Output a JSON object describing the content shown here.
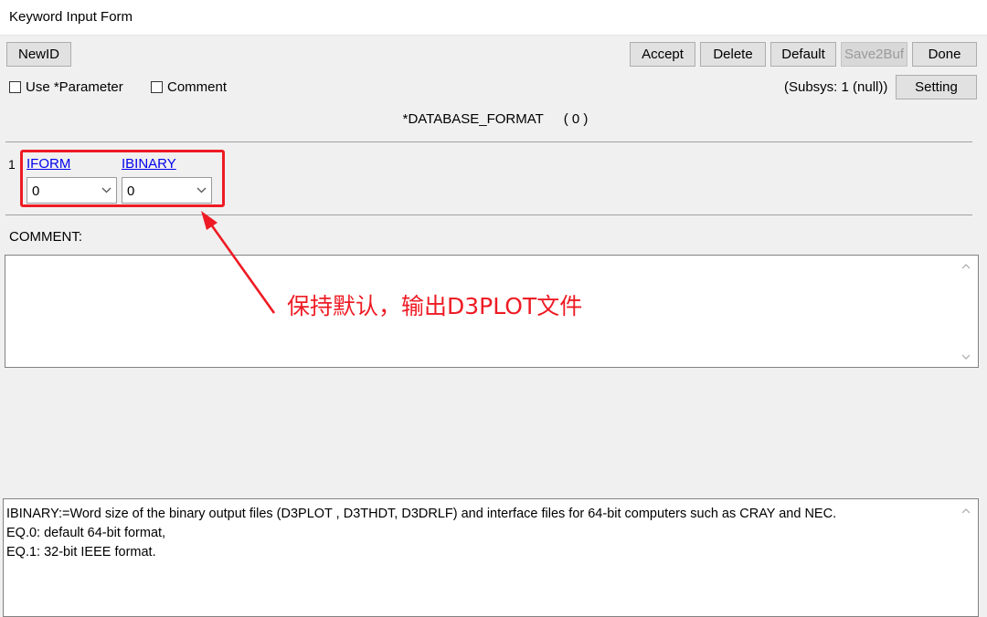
{
  "window": {
    "title": "Keyword Input Form"
  },
  "toolbar": {
    "newid": "NewID",
    "accept": "Accept",
    "delete": "Delete",
    "default": "Default",
    "save2buf": "Save2Buf",
    "done": "Done",
    "setting": "Setting"
  },
  "options": {
    "use_parameter": {
      "label": "Use *Parameter",
      "checked": false
    },
    "comment": {
      "label": "Comment",
      "checked": false
    }
  },
  "subsys": "(Subsys: 1 (null))",
  "keyword": {
    "name": "*DATABASE_FORMAT",
    "count": "( 0 )"
  },
  "card": {
    "row_number": "1",
    "fields": [
      {
        "name": "IFORM",
        "value": "0"
      },
      {
        "name": "IBINARY",
        "value": "0"
      }
    ]
  },
  "comment_section": {
    "label": "COMMENT:",
    "value": ""
  },
  "annotation": {
    "text": "保持默认，输出D3PLOT文件",
    "color": "#ee1b24"
  },
  "help": {
    "text": "IBINARY:=Word size of the binary output files (D3PLOT , D3THDT, D3DRLF) and interface files for 64-bit computers such as CRAY and NEC.\nEQ.0: default 64-bit format,\nEQ.1: 32-bit IEEE format."
  }
}
